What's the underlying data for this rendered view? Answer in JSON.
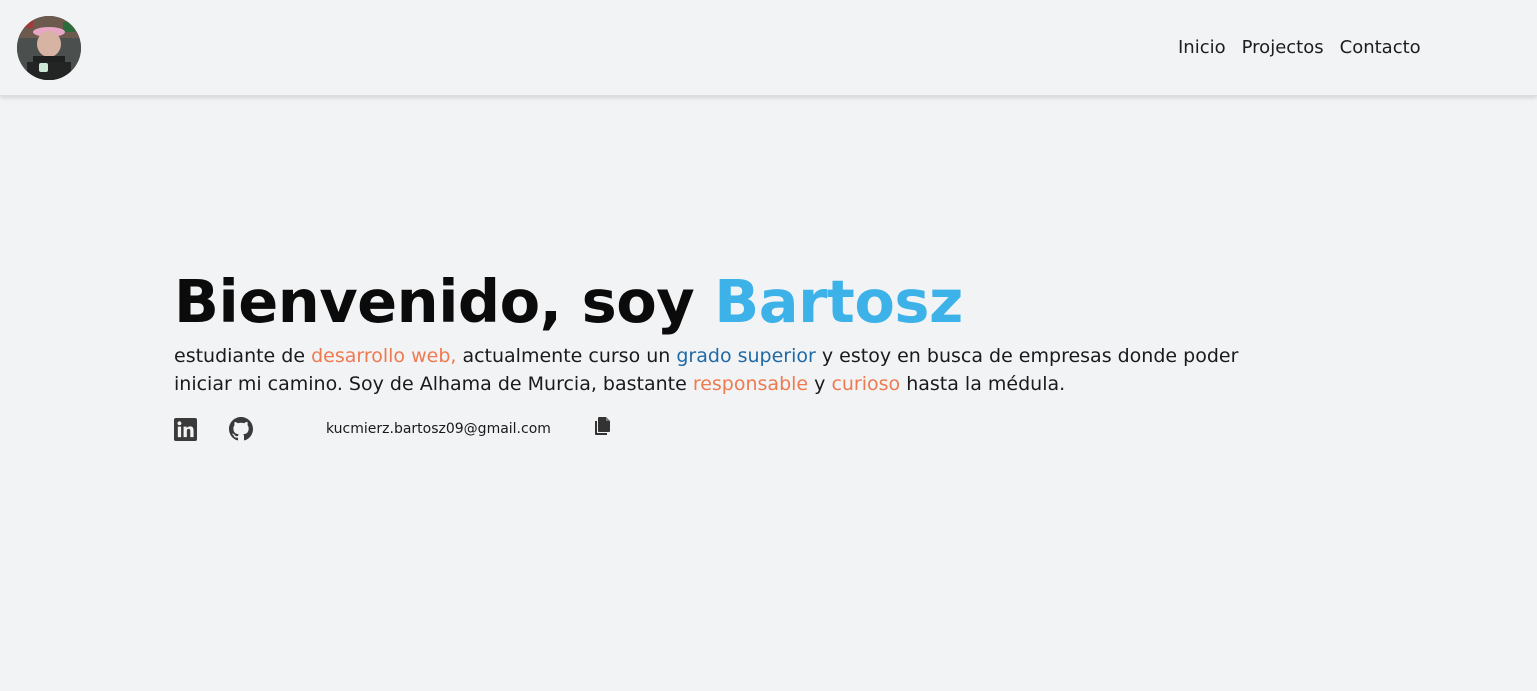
{
  "header": {
    "nav": [
      "Inicio",
      "Projectos",
      "Contacto"
    ]
  },
  "hero": {
    "title_prefix": "Bienvenido, soy ",
    "title_name": "Bartosz",
    "desc": {
      "p1": "estudiante de ",
      "h1": "desarrollo web,",
      "p2": " actualmente curso un ",
      "h2": "grado superior",
      "p3": " y estoy en busca de empresas donde poder iniciar mi camino. Soy de Alhama de Murcia, bastante ",
      "h3": "responsable",
      "p4": " y ",
      "h4": "curioso",
      "p5": " hasta la médula."
    }
  },
  "contact": {
    "email": "kucmierz.bartosz09@gmail.com",
    "icons": [
      "linkedin-icon",
      "github-icon",
      "copy-icon"
    ]
  },
  "colors": {
    "background": "#f2f3f5",
    "name_accent": "#3cb2e9",
    "highlight_orange": "#ee7a50",
    "highlight_blue": "#1f6aa6"
  }
}
